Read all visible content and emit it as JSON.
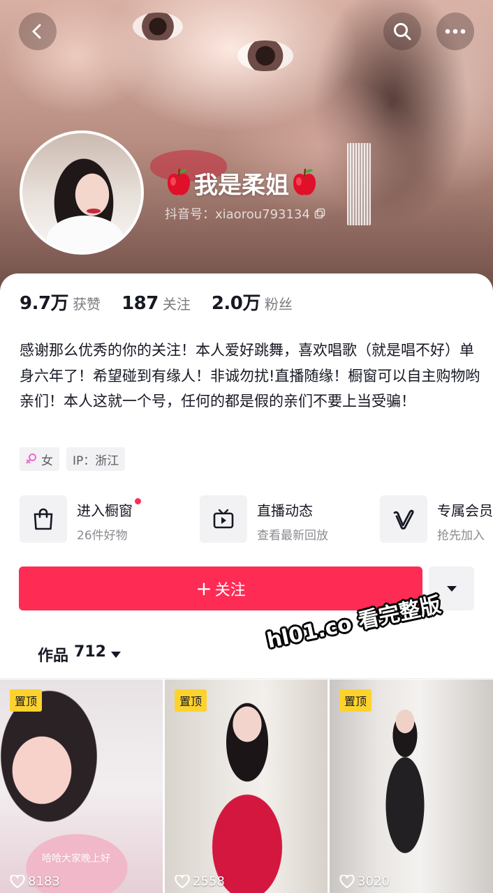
{
  "header": {
    "nickname": "我是柔姐",
    "douyin_id": "抖音号：xiaorou793134",
    "icons": [
      "back-arrow-icon",
      "search-icon",
      "more-dots-icon",
      "apple-emoji-icon",
      "copy-icon"
    ]
  },
  "stats": [
    {
      "value": "9.7万",
      "label": "获赞"
    },
    {
      "value": "187",
      "label": "关注"
    },
    {
      "value": "2.0万",
      "label": "粉丝"
    }
  ],
  "bio": "感谢那么优秀的你的关注！本人爱好跳舞，喜欢唱歌（就是唱不好）单身六年了！希望碰到有缘人！非诚勿扰!直播随缘！橱窗可以自主购物哟亲们！本人这就一个号，任何的都是假的亲们不要上当受骗！",
  "tags": {
    "gender": "女",
    "ip": "IP：浙江"
  },
  "services": [
    {
      "title": "进入橱窗",
      "subtitle": "26件好物",
      "icon": "shopping-bag-icon",
      "has_dot": true
    },
    {
      "title": "直播动态",
      "subtitle": "查看最新回放",
      "icon": "tv-icon",
      "has_dot": false
    },
    {
      "title": "专属会员",
      "subtitle": "抢先加入",
      "icon": "vip-v-icon",
      "has_dot": false
    }
  ],
  "follow_button": {
    "plus": "+",
    "label": "关注"
  },
  "works_tab": {
    "label": "作品",
    "count": "712"
  },
  "watermark": "hl01.co 看完整版",
  "videos": [
    {
      "badge": "置顶",
      "caption": "哈哈大家晚上好",
      "likes": "8183"
    },
    {
      "badge": "置顶",
      "caption": "",
      "likes": "2558"
    },
    {
      "badge": "置顶",
      "caption": "",
      "likes": "3020"
    }
  ],
  "colors": {
    "accent": "#fe2c55",
    "pin_badge": "#fdd22e",
    "panel": "#ffffff",
    "muted_text": "#7a7b80",
    "female_symbol": "#e86ad0"
  }
}
